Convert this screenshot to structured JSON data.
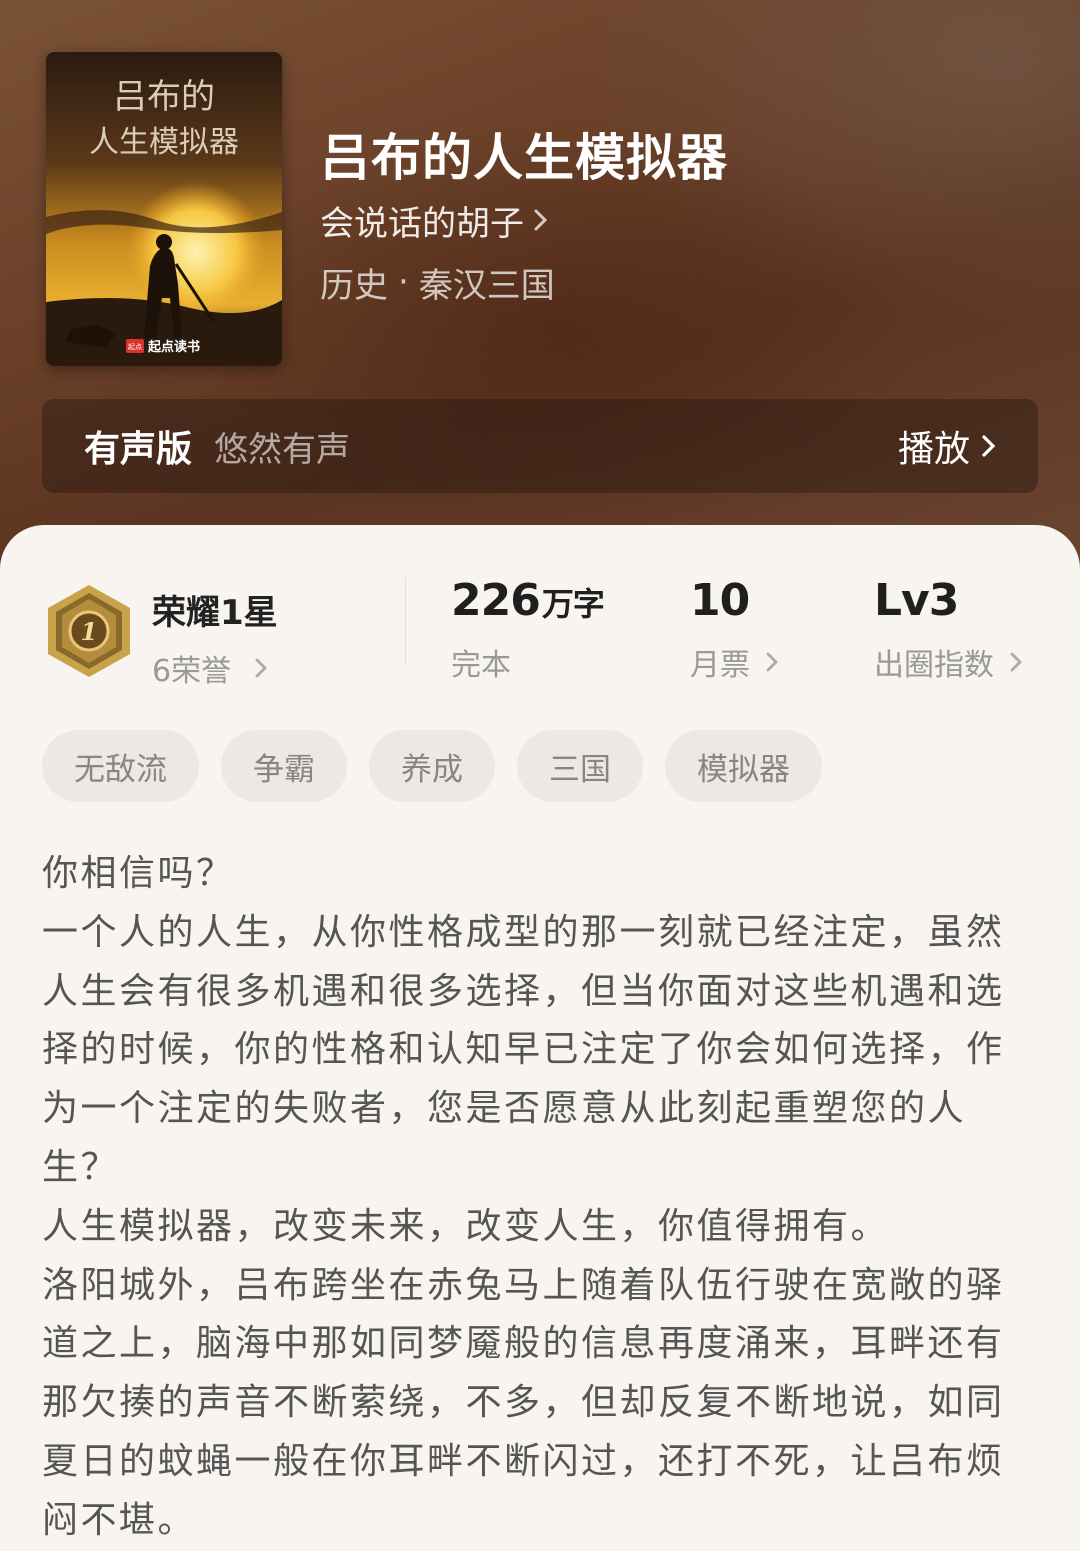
{
  "book": {
    "title": "吕布的人生模拟器",
    "author": "会说话的胡子",
    "category": "历史",
    "separator": "·",
    "subcategory": "秦汉三国",
    "cover": {
      "title_line1": "吕布的",
      "title_line2": "人生模拟器",
      "publisher": "起点读书",
      "logo_text": "起点"
    }
  },
  "audio": {
    "label": "有声版",
    "narrator": "悠然有声",
    "play_label": "播放"
  },
  "honor": {
    "badge_number": "1",
    "title": "荣耀1星",
    "subtitle": "6荣誉"
  },
  "stats": {
    "words": {
      "value": "226",
      "unit": "万字",
      "label": "完本"
    },
    "monthly": {
      "value": "10",
      "label": "月票"
    },
    "influence": {
      "value": "Lv3",
      "label": "出圈指数"
    }
  },
  "tags": [
    "无敌流",
    "争霸",
    "养成",
    "三国",
    "模拟器"
  ],
  "description": [
    "你相信吗？",
    "一个人的人生，从你性格成型的那一刻就已经注定，虽然人生会有很多机遇和很多选择，但当你面对这些机遇和选择的时候，你的性格和认知早已注定了你会如何选择，作为一个注定的失败者，您是否愿意从此刻起重塑您的人生？",
    "人生模拟器，改变未来，改变人生，你值得拥有。",
    "洛阳城外，吕布跨坐在赤兔马上随着队伍行驶在宽敞的驿道之上，脑海中那如同梦魇般的信息再度涌来，耳畔还有那欠揍的声音不断萦绕，不多，但却反复不断地说，如同夏日的蚊蝇一般在你耳畔不断闪过，还打不死，让吕布烦闷不堪。"
  ],
  "colors": {
    "hero_bg": "#6a4028",
    "card_bg": "#f8f4f0",
    "tag_bg": "#ede8e3",
    "badge_gold": "#c9a24a"
  }
}
